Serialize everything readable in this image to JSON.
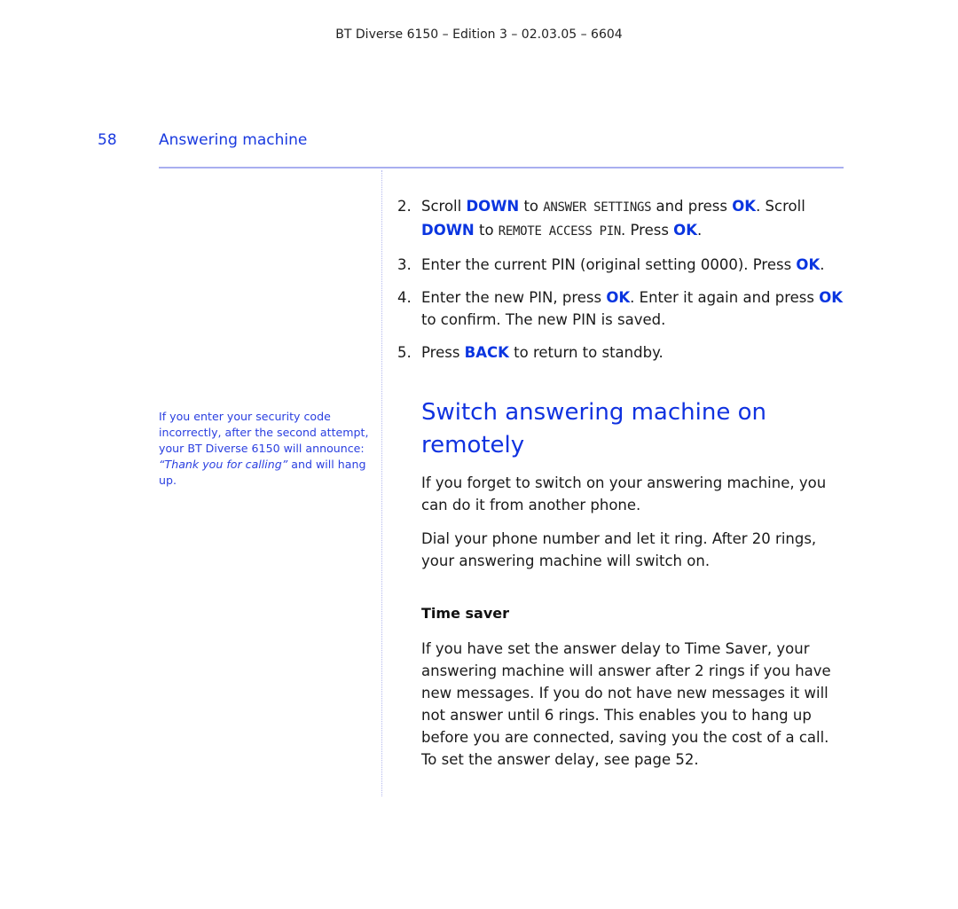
{
  "header": {
    "running_title": "BT Diverse 6150 – Edition 3 – 02.03.05 – 6604"
  },
  "page": {
    "number": "58",
    "section_title": "Answering machine"
  },
  "sidenote": {
    "text_before": "If you enter your security code incorrectly, after the second attempt, your BT Diverse 6150 will announce: ",
    "quote": "“Thank you for calling”",
    "text_after": " and will hang up."
  },
  "steps": [
    {
      "num": "2.",
      "parts": {
        "a": "Scroll ",
        "b": "DOWN",
        "c": " to ",
        "d": "ANSWER SETTINGS",
        "e": " and press ",
        "f": "OK",
        "g": ". Scroll ",
        "h": "DOWN",
        "i": " to ",
        "j": "REMOTE ACCESS PIN",
        "k": ". Press ",
        "l": "OK",
        "m": "."
      }
    },
    {
      "num": "3.",
      "parts": {
        "a": "Enter the current PIN (original setting 0000). Press ",
        "b": "OK",
        "c": "."
      }
    },
    {
      "num": "4.",
      "parts": {
        "a": "Enter the new PIN, press ",
        "b": "OK",
        "c": ". Enter it again and press ",
        "d": "OK",
        "e": " to confirm. The new PIN is saved."
      }
    },
    {
      "num": "5.",
      "parts": {
        "a": "Press ",
        "b": "BACK",
        "c": " to return to standby."
      }
    }
  ],
  "section2": {
    "heading": "Switch answering machine on remotely",
    "para1": "If you forget to switch on your answering machine, you can do it from another phone.",
    "para2": "Dial your phone number and let it ring. After 20 rings, your answering machine will switch on.",
    "subheading": "Time saver",
    "para3": "If you have set the answer delay to Time Saver, your answering machine will answer after 2 rings if you have new messages. If you do not have new messages it will not answer until 6 rings. This enables you to hang up before you are connected, saving you the cost of a call. To set the answer delay, see page 52."
  },
  "colors": {
    "accent_blue": "#1032e0",
    "rule": "#a8aff0"
  }
}
